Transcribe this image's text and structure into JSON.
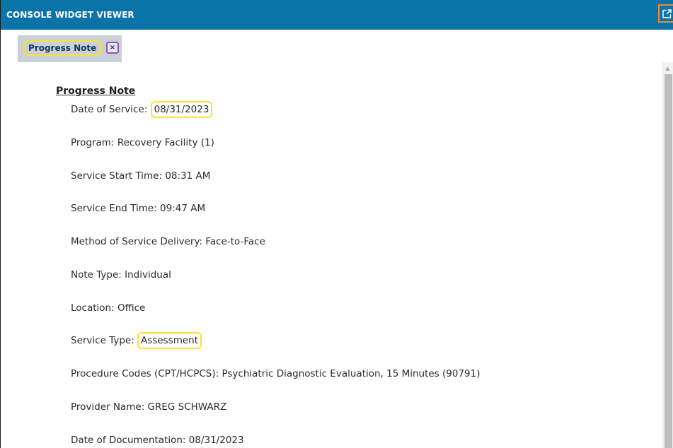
{
  "header": {
    "title": "CONSOLE WIDGET VIEWER",
    "popout_icon": "external-link-icon"
  },
  "tab": {
    "label": "Progress Note",
    "close_label": "×"
  },
  "note": {
    "heading": "Progress Note",
    "fields": [
      {
        "label": "Date of Service: ",
        "value": "08/31/2023",
        "highlighted": true
      },
      {
        "label": "Program: ",
        "value": "Recovery Facility (1)"
      },
      {
        "label": "Service Start Time: ",
        "value": "08:31 AM"
      },
      {
        "label": "Service End Time: ",
        "value": "09:47 AM"
      },
      {
        "label": "Method of Service Delivery: ",
        "value": "Face-to-Face"
      },
      {
        "label": "Note Type: ",
        "value": "Individual"
      },
      {
        "label": "Location: ",
        "value": "Office"
      },
      {
        "label": "Service Type: ",
        "value": "Assessment",
        "highlighted": true
      },
      {
        "label": "Procedure Codes (CPT/HCPCS): ",
        "value": "Psychiatric Diagnostic Evaluation, 15 Minutes (90791)"
      },
      {
        "label": "Provider Name: ",
        "value": "GREG SCHWARZ"
      },
      {
        "label": "Date of Documentation: ",
        "value": "08/31/2023"
      }
    ]
  },
  "colors": {
    "header_bg": "#0a73a8",
    "tab_bg": "#c9d1d8",
    "highlight": "#ffe033",
    "close_border": "#9b4fb8",
    "popout_border": "#f0883a"
  }
}
